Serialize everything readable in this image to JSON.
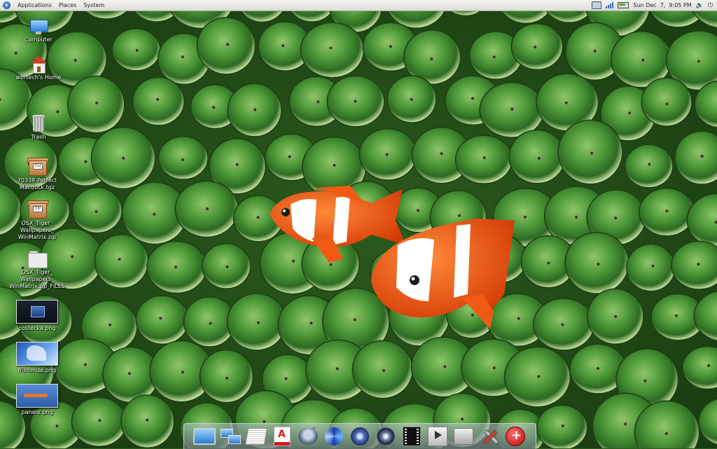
{
  "top_panel": {
    "menus": [
      "Applications",
      "Places",
      "System"
    ],
    "clock": "Sun Dec  7,  9:05 PM"
  },
  "desktop_icons": [
    {
      "label": "Computer",
      "icon": "computer-icon"
    },
    {
      "label": "wbrtech's Home",
      "icon": "home-folder-icon"
    },
    {
      "label": "Trash",
      "icon": "trash-icon"
    },
    {
      "label": "70338-Perfect\nMacdock.tgz",
      "icon": "archive-icon"
    },
    {
      "label": "OSX_Tiger_\nWallpapers_\nWinMatrix.zip",
      "icon": "archive-icon"
    },
    {
      "label": "OSX_Tiger_\nWallpapers_\nWinMatrix.zip_FILES",
      "icon": "folder-icon"
    },
    {
      "label": "costecka.png",
      "icon": "image-thumbnail"
    },
    {
      "label": "minimize.png",
      "icon": "image-thumbnail"
    },
    {
      "label": "panele.png",
      "icon": "image-thumbnail"
    }
  ],
  "dock_items": [
    "monitor-icon",
    "network-icon",
    "documents-icon",
    "pdf-reader-icon",
    "bowl-icon",
    "swirl-icon",
    "speaker-icon",
    "sound-icon",
    "film-icon",
    "media-player-icon",
    "drive-icon",
    "tools-icon",
    "add-ons-icon"
  ],
  "colors": {
    "wallpaper_green": "#2f5a1e",
    "clownfish_orange": "#e8500f",
    "panel_bg": "#e6e6e2"
  }
}
